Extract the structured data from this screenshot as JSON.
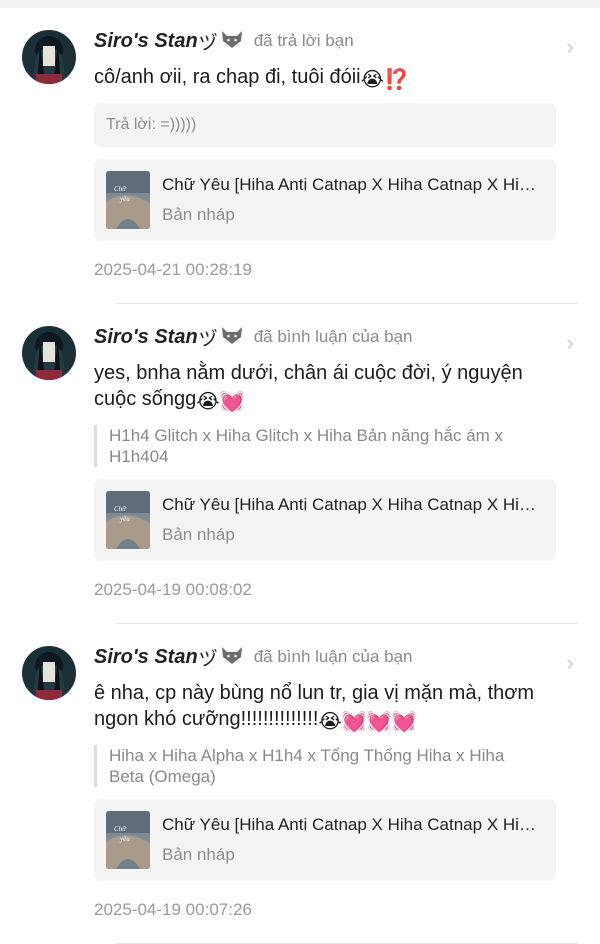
{
  "notifications": [
    {
      "user": {
        "name": "Siro's Stan",
        "mark": "ヅ",
        "wolf_icon": "wolf-icon"
      },
      "action": "đã trả lời bạn",
      "text": "cô/anh ơii, ra chap đi, tuôi đóii",
      "text_emojis": [
        "😭",
        "⁉️"
      ],
      "reply": "Trả lời: =)))))",
      "story": {
        "title": "Chữ Yêu [Hiha Anti Catnap X Hiha Catnap X Hiha ...",
        "status": "Bản nháp"
      },
      "time": "2025-04-21 00:28:19"
    },
    {
      "user": {
        "name": "Siro's Stan",
        "mark": "ヅ",
        "wolf_icon": "wolf-icon"
      },
      "action": "đã bình luận của bạn",
      "text": "yes, bnha nằm dưới, chân ái cuộc đời, ý nguyện cuộc sốngg",
      "text_emojis": [
        "😭",
        "💓"
      ],
      "quote": "H1h4 Glitch x Hiha Glitch x Hiha Bản năng hắc ám x H1h404",
      "story": {
        "title": "Chữ Yêu [Hiha Anti Catnap X Hiha Catnap X Hiha ...",
        "status": "Bản nháp"
      },
      "time": "2025-04-19 00:08:02"
    },
    {
      "user": {
        "name": "Siro's Stan",
        "mark": "ヅ",
        "wolf_icon": "wolf-icon"
      },
      "action": "đã bình luận của bạn",
      "text": "ê nha, cp này bùng nổ lun tr, gia vị mặn mà, thơm ngon khó cưỡng!!!!!!!!!!!!!!",
      "text_emojis": [
        "😭",
        "💓",
        "💓",
        "💓"
      ],
      "quote": "Hiha x Hiha Alpha x H1h4 x Tổng Thống Hiha x Hiha Beta (Omega)",
      "story": {
        "title": "Chữ Yêu [Hiha Anti Catnap X Hiha Catnap X Hiha ...",
        "status": "Bản nháp"
      },
      "time": "2025-04-19 00:07:26"
    }
  ],
  "colors": {
    "muted": "#8e8e8e",
    "card_bg": "#f4f4f4",
    "divider": "#e6e6e6"
  }
}
